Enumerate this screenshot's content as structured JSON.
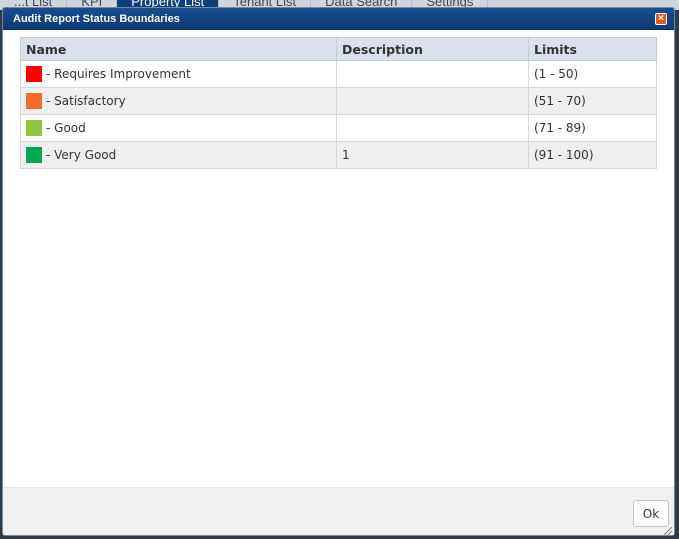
{
  "background": {
    "tabs": [
      "...t List",
      "KPI",
      "Property List",
      "Tenant List",
      "Data Search",
      "Settings"
    ],
    "active_tab": 2
  },
  "dialog": {
    "title": "Audit Report Status Boundaries",
    "close_label": "×",
    "ok_label": "Ok"
  },
  "table": {
    "headers": {
      "name": "Name",
      "description": "Description",
      "limits": "Limits"
    },
    "rows": [
      {
        "color": "#ff0000",
        "name": "- Requires Improvement",
        "description": "",
        "limits": "(1 - 50)"
      },
      {
        "color": "#f26b2a",
        "name": "- Satisfactory",
        "description": "",
        "limits": "(51 - 70)"
      },
      {
        "color": "#8dc63f",
        "name": "- Good",
        "description": "",
        "limits": "(71 - 89)"
      },
      {
        "color": "#00a651",
        "name": "- Very Good",
        "description": "1",
        "limits": "(91 - 100)"
      }
    ]
  }
}
